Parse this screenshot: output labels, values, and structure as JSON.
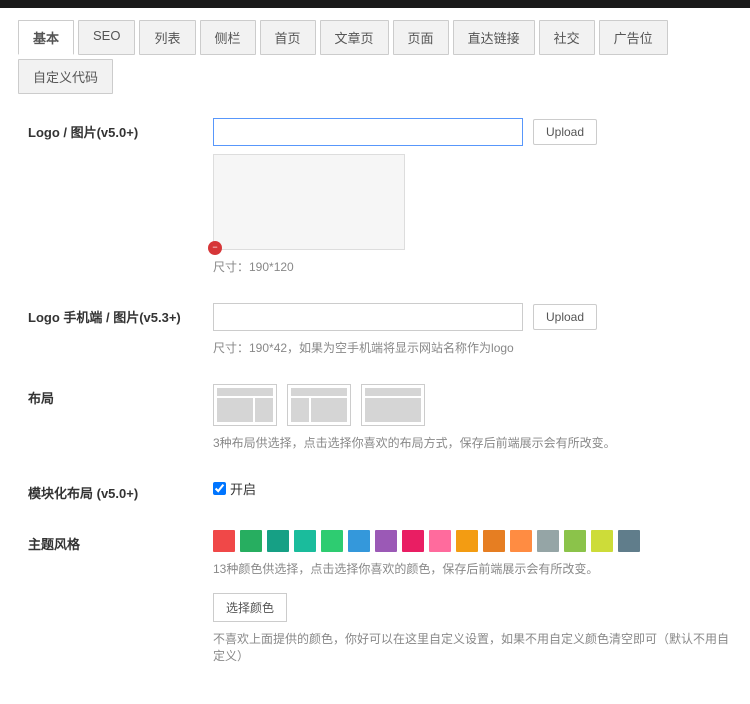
{
  "tabs": {
    "items": [
      {
        "label": "基本",
        "active": true
      },
      {
        "label": "SEO"
      },
      {
        "label": "列表"
      },
      {
        "label": "侧栏"
      },
      {
        "label": "首页"
      },
      {
        "label": "文章页"
      },
      {
        "label": "页面"
      },
      {
        "label": "直达链接"
      },
      {
        "label": "社交"
      },
      {
        "label": "广告位"
      },
      {
        "label": "自定义代码"
      }
    ]
  },
  "logo": {
    "label": "Logo / 图片(v5.0+)",
    "value": "",
    "upload": "Upload",
    "hint": "尺寸：190*120"
  },
  "logo_mobile": {
    "label": "Logo 手机端 / 图片(v5.3+)",
    "value": "",
    "upload": "Upload",
    "hint": "尺寸：190*42，如果为空手机端将显示网站名称作为logo"
  },
  "layout": {
    "label": "布局",
    "hint": "3种布局供选择，点击选择你喜欢的布局方式，保存后前端展示会有所改变。"
  },
  "modular": {
    "label": "模块化布局 (v5.0+)",
    "checkbox_label": "开启",
    "checked": true
  },
  "theme_style": {
    "label": "主题风格",
    "colors": [
      "#f04848",
      "#27ae60",
      "#16a085",
      "#1abc9c",
      "#2ecc71",
      "#3498db",
      "#9b59b6",
      "#e91e63",
      "#ff6b9d",
      "#f39c12",
      "#e67e22",
      "#ff8c42",
      "#95a5a6",
      "#8bc34a",
      "#cddc39",
      "#607d8b"
    ],
    "hint": "13种颜色供选择，点击选择你喜欢的颜色，保存后前端展示会有所改变。",
    "custom_btn": "选择颜色",
    "custom_hint": "不喜欢上面提供的颜色，你好可以在这里自定义设置，如果不用自定义颜色清空即可（默认不用自定义）"
  }
}
